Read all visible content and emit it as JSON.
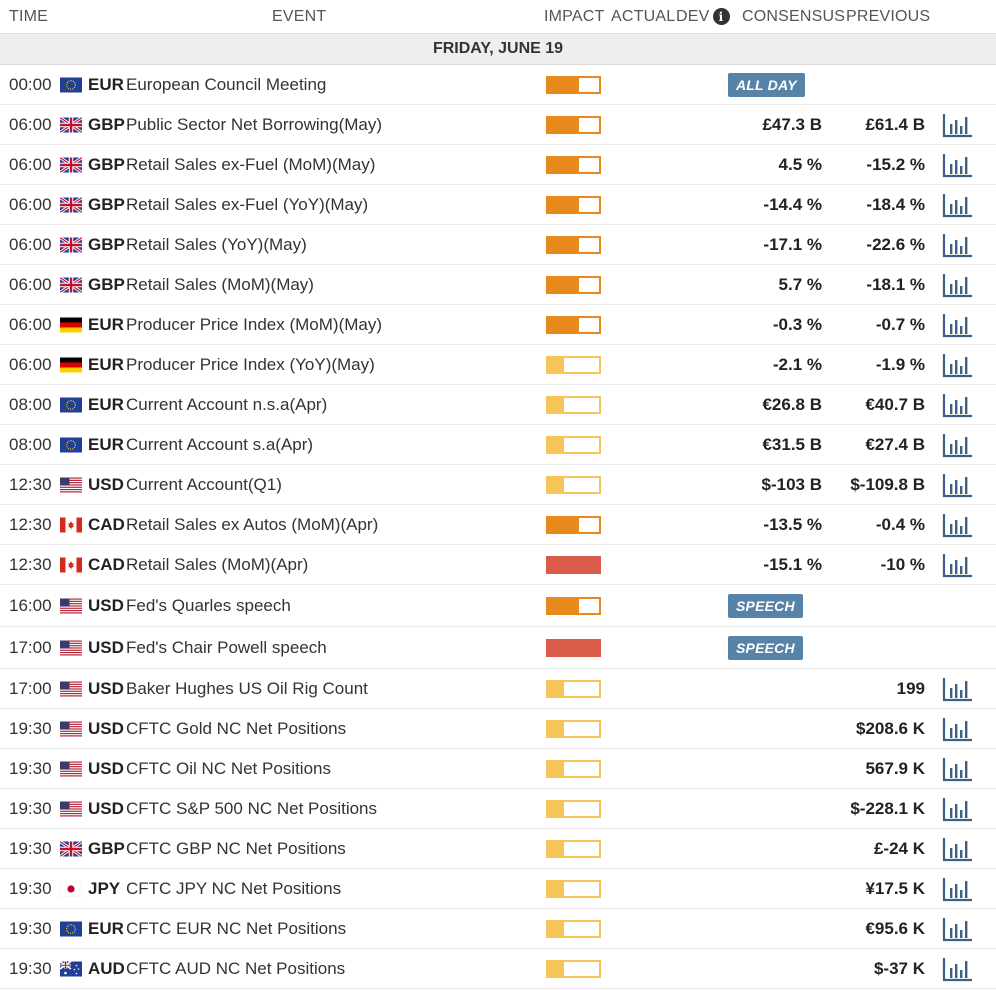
{
  "header": {
    "time": "TIME",
    "event": "EVENT",
    "impact": "IMPACT",
    "actual": "ACTUAL",
    "dev": "DEV",
    "consensus": "CONSENSUS",
    "previous": "PREVIOUS",
    "info_icon": "info-icon"
  },
  "day_label": "FRIDAY, JUNE 19",
  "colors": {
    "impact_high": "#d95b4a",
    "impact_medium": "#e8891b",
    "impact_low": "#f5c55a",
    "badge": "#5883a8",
    "chart_icon": "#3d6185"
  },
  "events": [
    {
      "time": "00:00",
      "flag": "eu",
      "currency": "EUR",
      "name": "European Council Meeting",
      "impact": "medium",
      "badge": "ALL DAY",
      "consensus": "",
      "previous": "",
      "chart": false
    },
    {
      "time": "06:00",
      "flag": "gb",
      "currency": "GBP",
      "name": "Public Sector Net Borrowing(May)",
      "impact": "medium",
      "badge": "",
      "consensus": "£47.3 B",
      "previous": "£61.4 B",
      "chart": true
    },
    {
      "time": "06:00",
      "flag": "gb",
      "currency": "GBP",
      "name": "Retail Sales ex-Fuel (MoM)(May)",
      "impact": "medium",
      "badge": "",
      "consensus": "4.5 %",
      "previous": "-15.2 %",
      "chart": true
    },
    {
      "time": "06:00",
      "flag": "gb",
      "currency": "GBP",
      "name": "Retail Sales ex-Fuel (YoY)(May)",
      "impact": "medium",
      "badge": "",
      "consensus": "-14.4 %",
      "previous": "-18.4 %",
      "chart": true
    },
    {
      "time": "06:00",
      "flag": "gb",
      "currency": "GBP",
      "name": "Retail Sales (YoY)(May)",
      "impact": "medium",
      "badge": "",
      "consensus": "-17.1 %",
      "previous": "-22.6 %",
      "chart": true
    },
    {
      "time": "06:00",
      "flag": "gb",
      "currency": "GBP",
      "name": "Retail Sales (MoM)(May)",
      "impact": "medium",
      "badge": "",
      "consensus": "5.7 %",
      "previous": "-18.1 %",
      "chart": true
    },
    {
      "time": "06:00",
      "flag": "de",
      "currency": "EUR",
      "name": "Producer Price Index (MoM)(May)",
      "impact": "medium",
      "badge": "",
      "consensus": "-0.3 %",
      "previous": "-0.7 %",
      "chart": true
    },
    {
      "time": "06:00",
      "flag": "de",
      "currency": "EUR",
      "name": "Producer Price Index (YoY)(May)",
      "impact": "low",
      "badge": "",
      "consensus": "-2.1 %",
      "previous": "-1.9 %",
      "chart": true
    },
    {
      "time": "08:00",
      "flag": "eu",
      "currency": "EUR",
      "name": "Current Account n.s.a(Apr)",
      "impact": "low",
      "badge": "",
      "consensus": "€26.8 B",
      "previous": "€40.7 B",
      "chart": true
    },
    {
      "time": "08:00",
      "flag": "eu",
      "currency": "EUR",
      "name": "Current Account s.a(Apr)",
      "impact": "low",
      "badge": "",
      "consensus": "€31.5 B",
      "previous": "€27.4 B",
      "chart": true
    },
    {
      "time": "12:30",
      "flag": "us",
      "currency": "USD",
      "name": "Current Account(Q1)",
      "impact": "low",
      "badge": "",
      "consensus": "$-103 B",
      "previous": "$-109.8 B",
      "chart": true
    },
    {
      "time": "12:30",
      "flag": "ca",
      "currency": "CAD",
      "name": "Retail Sales ex Autos (MoM)(Apr)",
      "impact": "medium",
      "badge": "",
      "consensus": "-13.5 %",
      "previous": "-0.4 %",
      "chart": true
    },
    {
      "time": "12:30",
      "flag": "ca",
      "currency": "CAD",
      "name": "Retail Sales (MoM)(Apr)",
      "impact": "high",
      "badge": "",
      "consensus": "-15.1 %",
      "previous": "-10 %",
      "chart": true
    },
    {
      "time": "16:00",
      "flag": "us",
      "currency": "USD",
      "name": "Fed's Quarles speech",
      "impact": "medium",
      "badge": "SPEECH",
      "consensus": "",
      "previous": "",
      "chart": false,
      "tall": true
    },
    {
      "time": "17:00",
      "flag": "us",
      "currency": "USD",
      "name": "Fed's Chair Powell speech",
      "impact": "high",
      "badge": "SPEECH",
      "consensus": "",
      "previous": "",
      "chart": false,
      "tall": true
    },
    {
      "time": "17:00",
      "flag": "us",
      "currency": "USD",
      "name": "Baker Hughes US Oil Rig Count",
      "impact": "low",
      "badge": "",
      "consensus": "",
      "previous": "199",
      "chart": true
    },
    {
      "time": "19:30",
      "flag": "us",
      "currency": "USD",
      "name": "CFTC Gold NC Net Positions",
      "impact": "low",
      "badge": "",
      "consensus": "",
      "previous": "$208.6 K",
      "chart": true
    },
    {
      "time": "19:30",
      "flag": "us",
      "currency": "USD",
      "name": "CFTC Oil NC Net Positions",
      "impact": "low",
      "badge": "",
      "consensus": "",
      "previous": "567.9 K",
      "chart": true
    },
    {
      "time": "19:30",
      "flag": "us",
      "currency": "USD",
      "name": "CFTC S&P 500 NC Net Positions",
      "impact": "low",
      "badge": "",
      "consensus": "",
      "previous": "$-228.1 K",
      "chart": true
    },
    {
      "time": "19:30",
      "flag": "gb",
      "currency": "GBP",
      "name": "CFTC GBP NC Net Positions",
      "impact": "low",
      "badge": "",
      "consensus": "",
      "previous": "£-24 K",
      "chart": true
    },
    {
      "time": "19:30",
      "flag": "jp",
      "currency": "JPY",
      "name": "CFTC JPY NC Net Positions",
      "impact": "low",
      "badge": "",
      "consensus": "",
      "previous": "¥17.5 K",
      "chart": true
    },
    {
      "time": "19:30",
      "flag": "eu",
      "currency": "EUR",
      "name": "CFTC EUR NC Net Positions",
      "impact": "low",
      "badge": "",
      "consensus": "",
      "previous": "€95.6 K",
      "chart": true
    },
    {
      "time": "19:30",
      "flag": "au",
      "currency": "AUD",
      "name": "CFTC AUD NC Net Positions",
      "impact": "low",
      "badge": "",
      "consensus": "",
      "previous": "$-37 K",
      "chart": true
    }
  ]
}
